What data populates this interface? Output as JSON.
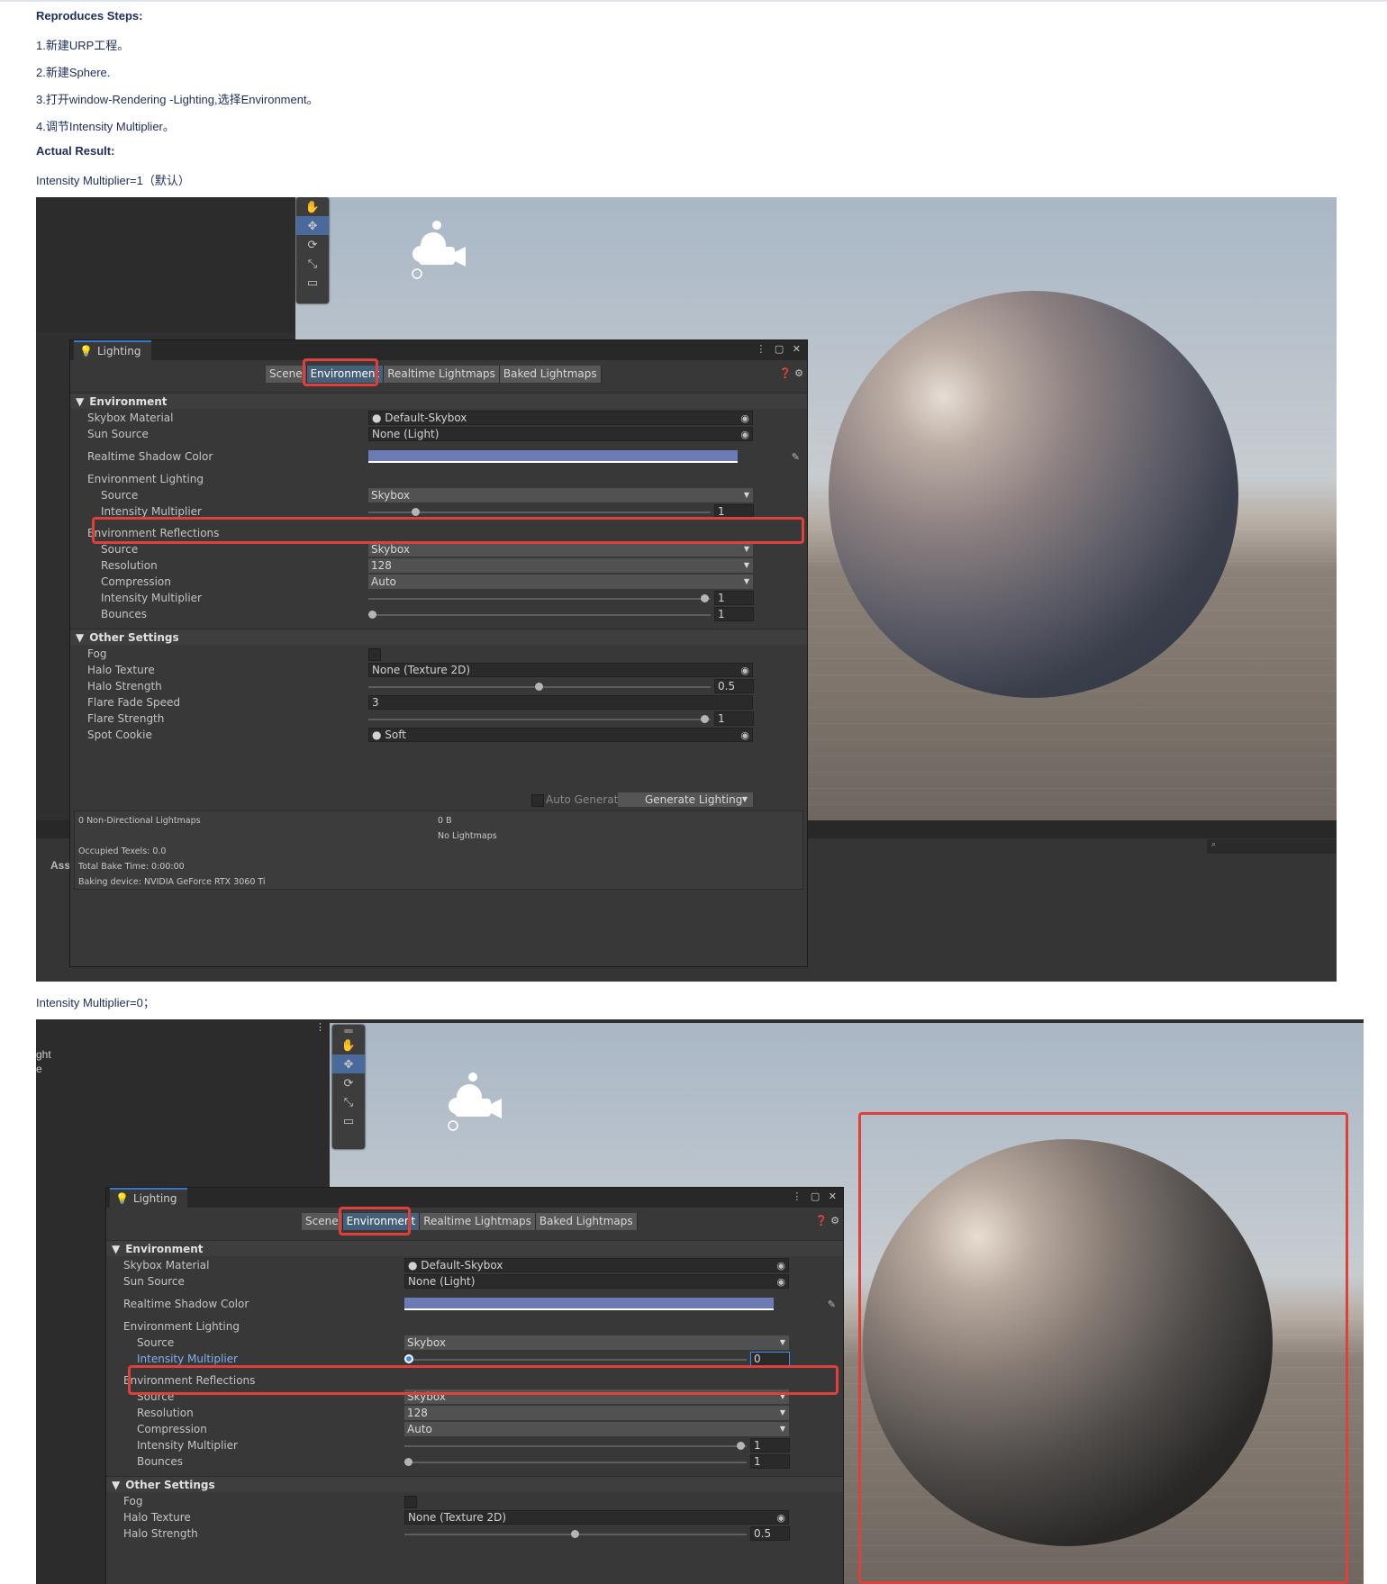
{
  "doc": {
    "heading_steps": "Reproduces Steps:",
    "step1": "1.新建URP工程。",
    "step2": "2.新建Sphere.",
    "step3": "3.打开window-Rendering -Lighting,选择Environment。",
    "step4": "4.调节Intensity Multiplier。",
    "heading_actual": "Actual Result:",
    "caption1": "Intensity Multiplier=1（默认）",
    "caption2": "Intensity Multiplier=0；"
  },
  "lighting_window": {
    "title": "Lighting",
    "tabs": [
      "Scene",
      "Environment",
      "Realtime Lightmaps",
      "Baked Lightmaps"
    ],
    "selected_tab": "Environment",
    "environment": {
      "header": "Environment",
      "skybox_material_label": "Skybox Material",
      "skybox_material_value": "Default-Skybox",
      "sun_source_label": "Sun Source",
      "sun_source_value": "None (Light)",
      "realtime_shadow_color_label": "Realtime Shadow Color",
      "realtime_shadow_color": "#6c7ab5",
      "env_lighting_label": "Environment Lighting",
      "source_label": "Source",
      "source_value": "Skybox",
      "intensity_label": "Intensity Multiplier"
    },
    "reflections": {
      "header": "Environment Reflections",
      "source_label": "Source",
      "source_value": "Skybox",
      "resolution_label": "Resolution",
      "resolution_value": "128",
      "compression_label": "Compression",
      "compression_value": "Auto",
      "intensity_label": "Intensity Multiplier",
      "intensity_value": "1",
      "bounces_label": "Bounces",
      "bounces_value": "1"
    },
    "other": {
      "header": "Other Settings",
      "fog_label": "Fog",
      "halo_texture_label": "Halo Texture",
      "halo_texture_value": "None (Texture 2D)",
      "halo_strength_label": "Halo Strength",
      "halo_strength_value": "0.5",
      "flare_fade_label": "Flare Fade Speed",
      "flare_fade_value": "3",
      "flare_strength_label": "Flare Strength",
      "flare_strength_value": "1",
      "spot_cookie_label": "Spot Cookie",
      "spot_cookie_value": "Soft"
    },
    "footer": {
      "auto_generate": "Auto Generate",
      "generate_button": "Generate Lighting",
      "lightmaps": "0 Non-Directional Lightmaps",
      "size": "0 B",
      "no_lightmaps": "No Lightmaps",
      "occupied": "Occupied Texels: 0.0",
      "bake_time": "Total Bake Time: 0:00:00",
      "device": "Baking device: NVIDIA GeForce RTX 3060 Ti"
    }
  },
  "shot1": {
    "intensity_value": "1",
    "intensity_level": 0.125
  },
  "shot2": {
    "intensity_value": "0",
    "intensity_level": 0.0,
    "side_text_1": "ght",
    "side_text_2": "e",
    "assets_stub": "Ass"
  },
  "colors": {
    "highlight": "#e0403c",
    "accent_tab": "#46607c",
    "focus_knob": "#3e8ff0"
  }
}
